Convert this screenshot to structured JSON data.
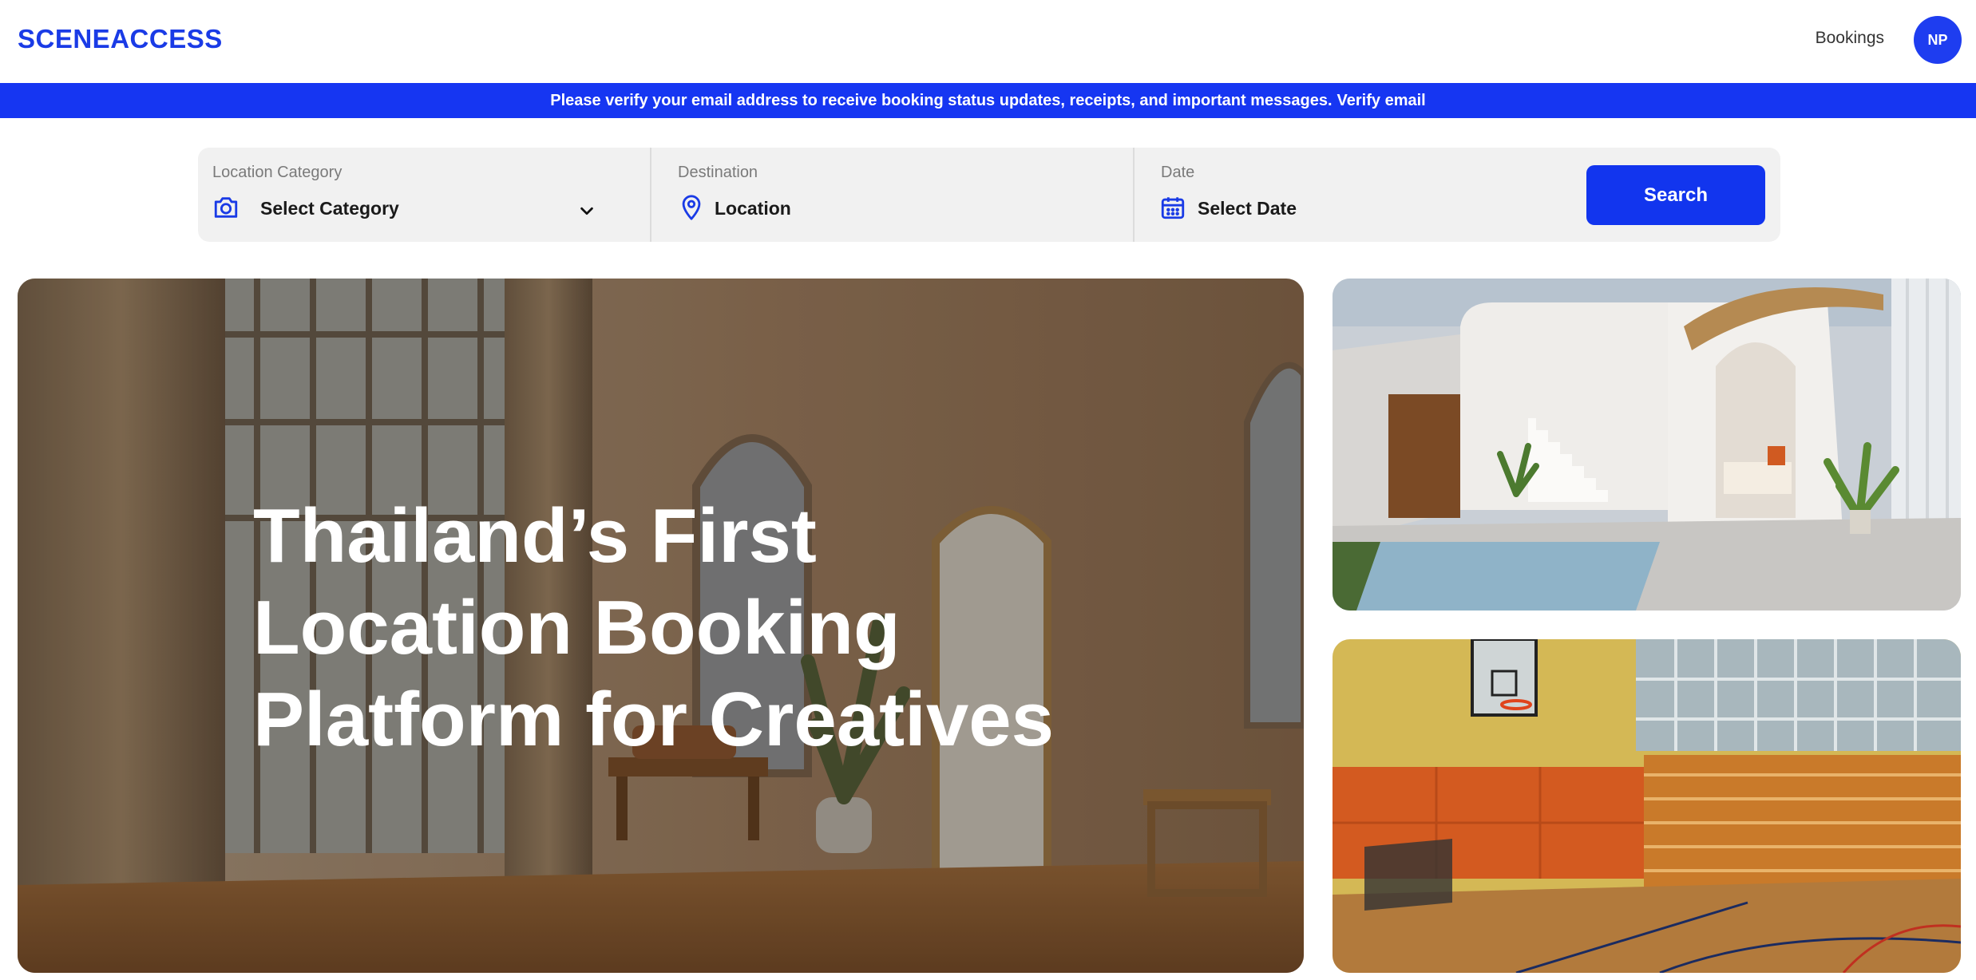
{
  "header": {
    "logo_text": "SCENEACCESS",
    "bookings_label": "Bookings",
    "avatar_initials": "NP"
  },
  "banner": {
    "message": "Please verify your email address to receive booking status updates, receipts, and important messages.",
    "link_label": "Verify email"
  },
  "search": {
    "category": {
      "label": "Location Category",
      "value": "Select Category",
      "icon": "camera-icon"
    },
    "destination": {
      "label": "Destination",
      "value": "Location",
      "icon": "map-pin-icon"
    },
    "date": {
      "label": "Date",
      "value": "Select Date",
      "icon": "calendar-icon"
    },
    "button_label": "Search"
  },
  "hero": {
    "title_lines": [
      "Thailand’s First",
      "Location Booking",
      "Platform for Creatives"
    ]
  },
  "colors": {
    "brand": "#1a3be6",
    "banner": "#1636f2",
    "search_button": "#1235ee",
    "search_bg": "#f1f1f1"
  }
}
